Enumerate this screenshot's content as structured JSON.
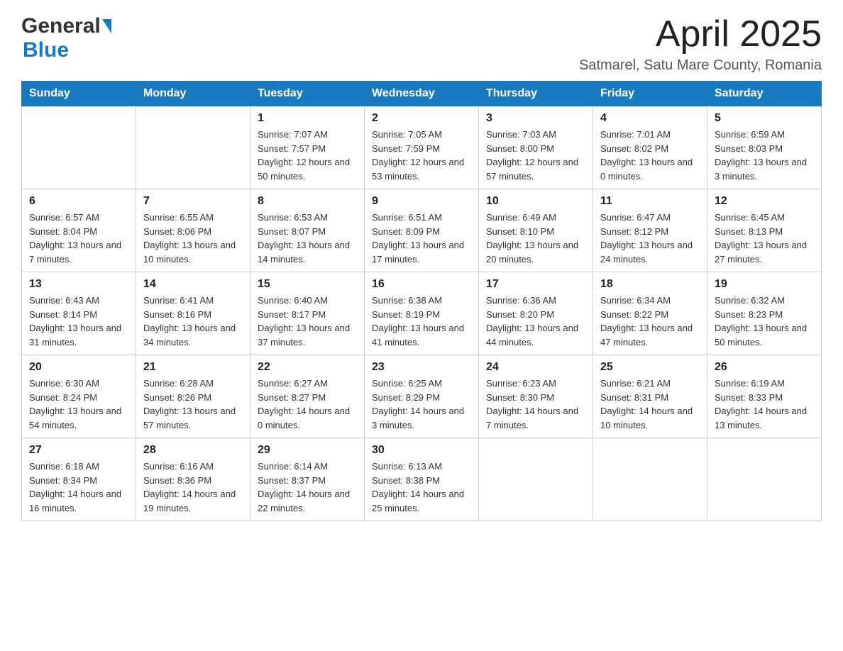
{
  "header": {
    "title": "April 2025",
    "subtitle": "Satmarel, Satu Mare County, Romania"
  },
  "logo": {
    "general": "General",
    "blue": "Blue"
  },
  "days": [
    "Sunday",
    "Monday",
    "Tuesday",
    "Wednesday",
    "Thursday",
    "Friday",
    "Saturday"
  ],
  "weeks": [
    [
      {
        "day": "",
        "sunrise": "",
        "sunset": "",
        "daylight": ""
      },
      {
        "day": "",
        "sunrise": "",
        "sunset": "",
        "daylight": ""
      },
      {
        "day": "1",
        "sunrise": "Sunrise: 7:07 AM",
        "sunset": "Sunset: 7:57 PM",
        "daylight": "Daylight: 12 hours and 50 minutes."
      },
      {
        "day": "2",
        "sunrise": "Sunrise: 7:05 AM",
        "sunset": "Sunset: 7:59 PM",
        "daylight": "Daylight: 12 hours and 53 minutes."
      },
      {
        "day": "3",
        "sunrise": "Sunrise: 7:03 AM",
        "sunset": "Sunset: 8:00 PM",
        "daylight": "Daylight: 12 hours and 57 minutes."
      },
      {
        "day": "4",
        "sunrise": "Sunrise: 7:01 AM",
        "sunset": "Sunset: 8:02 PM",
        "daylight": "Daylight: 13 hours and 0 minutes."
      },
      {
        "day": "5",
        "sunrise": "Sunrise: 6:59 AM",
        "sunset": "Sunset: 8:03 PM",
        "daylight": "Daylight: 13 hours and 3 minutes."
      }
    ],
    [
      {
        "day": "6",
        "sunrise": "Sunrise: 6:57 AM",
        "sunset": "Sunset: 8:04 PM",
        "daylight": "Daylight: 13 hours and 7 minutes."
      },
      {
        "day": "7",
        "sunrise": "Sunrise: 6:55 AM",
        "sunset": "Sunset: 8:06 PM",
        "daylight": "Daylight: 13 hours and 10 minutes."
      },
      {
        "day": "8",
        "sunrise": "Sunrise: 6:53 AM",
        "sunset": "Sunset: 8:07 PM",
        "daylight": "Daylight: 13 hours and 14 minutes."
      },
      {
        "day": "9",
        "sunrise": "Sunrise: 6:51 AM",
        "sunset": "Sunset: 8:09 PM",
        "daylight": "Daylight: 13 hours and 17 minutes."
      },
      {
        "day": "10",
        "sunrise": "Sunrise: 6:49 AM",
        "sunset": "Sunset: 8:10 PM",
        "daylight": "Daylight: 13 hours and 20 minutes."
      },
      {
        "day": "11",
        "sunrise": "Sunrise: 6:47 AM",
        "sunset": "Sunset: 8:12 PM",
        "daylight": "Daylight: 13 hours and 24 minutes."
      },
      {
        "day": "12",
        "sunrise": "Sunrise: 6:45 AM",
        "sunset": "Sunset: 8:13 PM",
        "daylight": "Daylight: 13 hours and 27 minutes."
      }
    ],
    [
      {
        "day": "13",
        "sunrise": "Sunrise: 6:43 AM",
        "sunset": "Sunset: 8:14 PM",
        "daylight": "Daylight: 13 hours and 31 minutes."
      },
      {
        "day": "14",
        "sunrise": "Sunrise: 6:41 AM",
        "sunset": "Sunset: 8:16 PM",
        "daylight": "Daylight: 13 hours and 34 minutes."
      },
      {
        "day": "15",
        "sunrise": "Sunrise: 6:40 AM",
        "sunset": "Sunset: 8:17 PM",
        "daylight": "Daylight: 13 hours and 37 minutes."
      },
      {
        "day": "16",
        "sunrise": "Sunrise: 6:38 AM",
        "sunset": "Sunset: 8:19 PM",
        "daylight": "Daylight: 13 hours and 41 minutes."
      },
      {
        "day": "17",
        "sunrise": "Sunrise: 6:36 AM",
        "sunset": "Sunset: 8:20 PM",
        "daylight": "Daylight: 13 hours and 44 minutes."
      },
      {
        "day": "18",
        "sunrise": "Sunrise: 6:34 AM",
        "sunset": "Sunset: 8:22 PM",
        "daylight": "Daylight: 13 hours and 47 minutes."
      },
      {
        "day": "19",
        "sunrise": "Sunrise: 6:32 AM",
        "sunset": "Sunset: 8:23 PM",
        "daylight": "Daylight: 13 hours and 50 minutes."
      }
    ],
    [
      {
        "day": "20",
        "sunrise": "Sunrise: 6:30 AM",
        "sunset": "Sunset: 8:24 PM",
        "daylight": "Daylight: 13 hours and 54 minutes."
      },
      {
        "day": "21",
        "sunrise": "Sunrise: 6:28 AM",
        "sunset": "Sunset: 8:26 PM",
        "daylight": "Daylight: 13 hours and 57 minutes."
      },
      {
        "day": "22",
        "sunrise": "Sunrise: 6:27 AM",
        "sunset": "Sunset: 8:27 PM",
        "daylight": "Daylight: 14 hours and 0 minutes."
      },
      {
        "day": "23",
        "sunrise": "Sunrise: 6:25 AM",
        "sunset": "Sunset: 8:29 PM",
        "daylight": "Daylight: 14 hours and 3 minutes."
      },
      {
        "day": "24",
        "sunrise": "Sunrise: 6:23 AM",
        "sunset": "Sunset: 8:30 PM",
        "daylight": "Daylight: 14 hours and 7 minutes."
      },
      {
        "day": "25",
        "sunrise": "Sunrise: 6:21 AM",
        "sunset": "Sunset: 8:31 PM",
        "daylight": "Daylight: 14 hours and 10 minutes."
      },
      {
        "day": "26",
        "sunrise": "Sunrise: 6:19 AM",
        "sunset": "Sunset: 8:33 PM",
        "daylight": "Daylight: 14 hours and 13 minutes."
      }
    ],
    [
      {
        "day": "27",
        "sunrise": "Sunrise: 6:18 AM",
        "sunset": "Sunset: 8:34 PM",
        "daylight": "Daylight: 14 hours and 16 minutes."
      },
      {
        "day": "28",
        "sunrise": "Sunrise: 6:16 AM",
        "sunset": "Sunset: 8:36 PM",
        "daylight": "Daylight: 14 hours and 19 minutes."
      },
      {
        "day": "29",
        "sunrise": "Sunrise: 6:14 AM",
        "sunset": "Sunset: 8:37 PM",
        "daylight": "Daylight: 14 hours and 22 minutes."
      },
      {
        "day": "30",
        "sunrise": "Sunrise: 6:13 AM",
        "sunset": "Sunset: 8:38 PM",
        "daylight": "Daylight: 14 hours and 25 minutes."
      },
      {
        "day": "",
        "sunrise": "",
        "sunset": "",
        "daylight": ""
      },
      {
        "day": "",
        "sunrise": "",
        "sunset": "",
        "daylight": ""
      },
      {
        "day": "",
        "sunrise": "",
        "sunset": "",
        "daylight": ""
      }
    ]
  ]
}
